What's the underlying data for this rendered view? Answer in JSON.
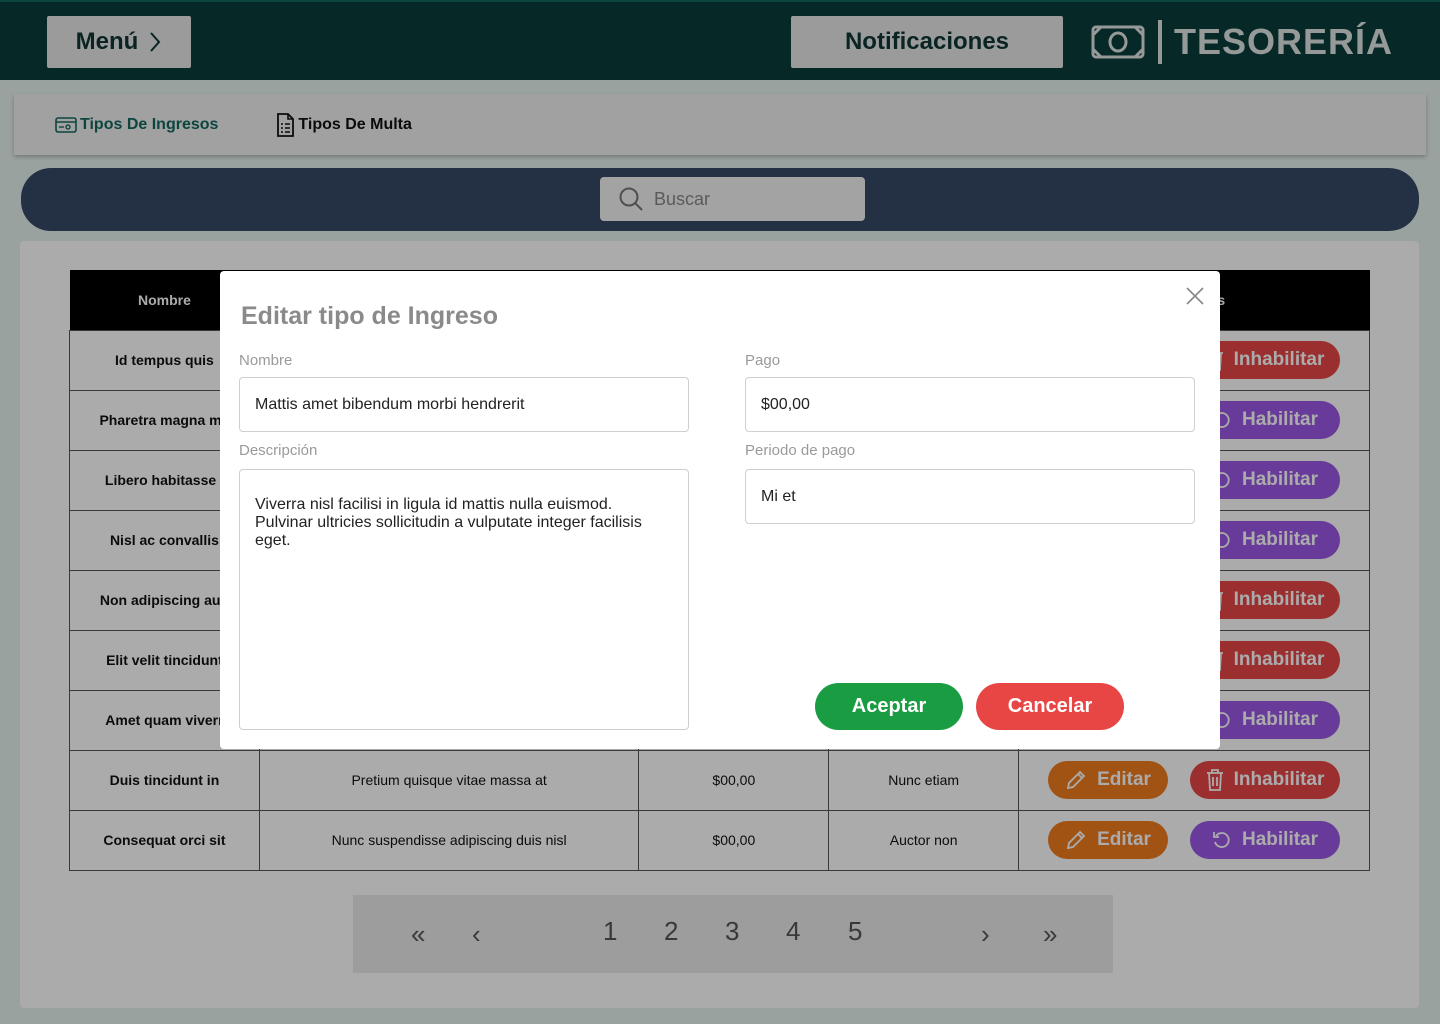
{
  "header": {
    "menu_label": "Menú",
    "notifications_label": "Notificaciones",
    "brand_title": "TESORERÍA"
  },
  "tabs": [
    {
      "label": "Tipos De Ingresos",
      "active": true,
      "icon": "money-card-icon"
    },
    {
      "label": "Tipos De Multa",
      "active": false,
      "icon": "document-icon"
    }
  ],
  "search": {
    "placeholder": "Buscar"
  },
  "table": {
    "columns": [
      "Nombre",
      "Acciones"
    ],
    "rows": [
      {
        "nombre": "Id tempus quis",
        "descripcion": "",
        "pago": "",
        "periodo": "",
        "action": "Inhabilitar"
      },
      {
        "nombre": "Pharetra magna ma",
        "descripcion": "",
        "pago": "",
        "periodo": "",
        "action": "Habilitar"
      },
      {
        "nombre": "Libero habitasse i",
        "descripcion": "",
        "pago": "",
        "periodo": "",
        "action": "Habilitar"
      },
      {
        "nombre": "Nisl ac convallis",
        "descripcion": "",
        "pago": "",
        "periodo": "",
        "action": "Habilitar"
      },
      {
        "nombre": "Non adipiscing aug",
        "descripcion": "",
        "pago": "",
        "periodo": "",
        "action": "Inhabilitar"
      },
      {
        "nombre": "Elit velit tincidunt",
        "descripcion": "",
        "pago": "",
        "periodo": "",
        "action": "Inhabilitar"
      },
      {
        "nombre": "Amet quam viverr",
        "descripcion": "",
        "pago": "",
        "periodo": "",
        "action": "Habilitar"
      },
      {
        "nombre": "Duis tincidunt in",
        "descripcion": "Pretium quisque vitae massa at",
        "pago": "$00,00",
        "periodo": "Nunc etiam",
        "action": "Inhabilitar"
      },
      {
        "nombre": "Consequat orci sit",
        "descripcion": "Nunc suspendisse adipiscing duis nisl",
        "pago": "$00,00",
        "periodo": "Auctor non",
        "action": "Habilitar"
      }
    ],
    "edit_label": "Editar",
    "disable_label": "Inhabilitar",
    "enable_label": "Habilitar"
  },
  "pagination": {
    "pages": [
      "1",
      "2",
      "3",
      "4",
      "5"
    ],
    "first": "«",
    "prev": "‹",
    "next": "›",
    "last": "»"
  },
  "modal": {
    "title": "Editar tipo de Ingreso",
    "nombre_label": "Nombre",
    "nombre_value": "Mattis amet bibendum morbi hendrerit",
    "descripcion_label": "Descripción",
    "descripcion_value": "Viverra nisl facilisi in ligula id mattis nulla euismod. Pulvinar ultricies sollicitudin a vulputate integer facilisis eget.",
    "pago_label": "Pago",
    "pago_value": "$00,00",
    "periodo_label": "Periodo de pago",
    "periodo_value": "Mi et",
    "accept_label": "Aceptar",
    "cancel_label": "Cancelar"
  },
  "colors": {
    "header_bg": "#0a3d3a",
    "accent": "#14695f",
    "edit": "#f07d1f",
    "disable": "#e84545",
    "enable": "#9b59e6",
    "accept": "#1a9c43"
  }
}
